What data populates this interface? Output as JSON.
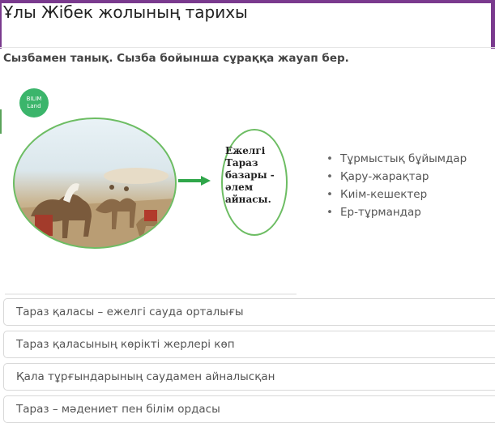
{
  "header": {
    "title": "Ұлы Жібек жолының тарихы",
    "accent_color": "#7a3a8e"
  },
  "question": {
    "text": "Сызбамен танық. Сызба бойынша сұраққа жауап бер."
  },
  "figure": {
    "logo": {
      "line1": "BILIM",
      "line2": "Land"
    },
    "oval_text": "Ежелгі Тараз базары - әлем айнасы.",
    "bullets": [
      "Тұрмыстық бұйымдар",
      "Қару-жарақтар",
      "Киім-кешектер",
      "Ер-тұрмандар"
    ],
    "accent_green": "#6dbd63",
    "arrow_icon": "right-arrow-icon"
  },
  "options": [
    {
      "label": "Тараз қаласы – ежелгі сауда орталығы"
    },
    {
      "label": "Тараз қаласының көрікті жерлері көп"
    },
    {
      "label": "Қала тұрғындарының саудамен айналысқан"
    },
    {
      "label": "Тараз – мәдениет пен білім ордасы"
    }
  ]
}
